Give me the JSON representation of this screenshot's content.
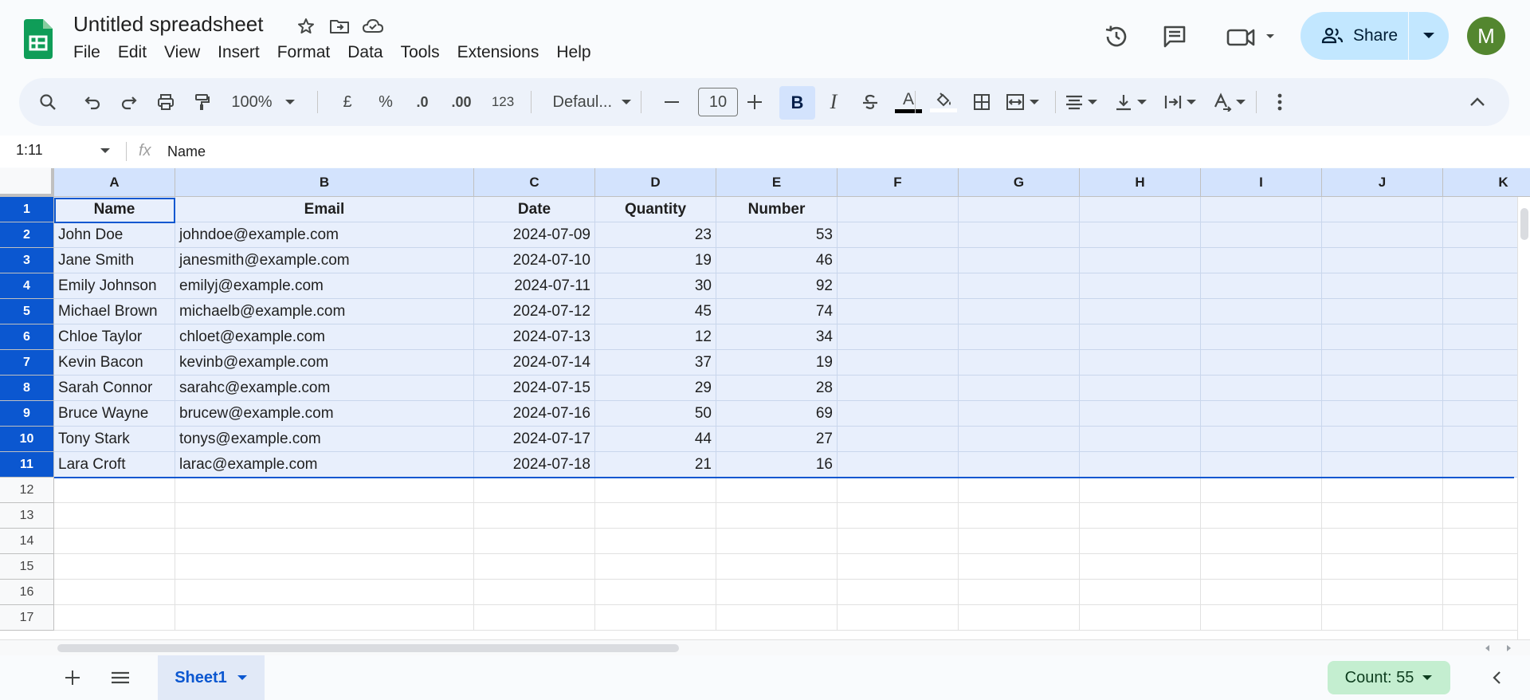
{
  "app": {
    "title": "Untitled spreadsheet",
    "avatar_letter": "M",
    "share_label": "Share"
  },
  "menu": [
    "File",
    "Edit",
    "View",
    "Insert",
    "Format",
    "Data",
    "Tools",
    "Extensions",
    "Help"
  ],
  "toolbar": {
    "zoom": "100%",
    "currency": "£",
    "percent": "%",
    "dec_decrease": ".0",
    "dec_increase": ".00",
    "number_format": "123",
    "font": "Defaul...",
    "font_size": "10",
    "bold": "B",
    "italic": "I",
    "text_color_glyph": "A"
  },
  "formula_bar": {
    "name_box": "1:11",
    "fx": "fx",
    "value": "Name"
  },
  "columns": [
    "A",
    "B",
    "C",
    "D",
    "E",
    "F",
    "G",
    "H",
    "I",
    "J",
    "K"
  ],
  "rows": [
    [
      "Name",
      "Email",
      "Date",
      "Quantity",
      "Number"
    ],
    [
      "John Doe",
      "johndoe@example.com",
      "2024-07-09",
      "23",
      "53"
    ],
    [
      "Jane Smith",
      "janesmith@example.com",
      "2024-07-10",
      "19",
      "46"
    ],
    [
      "Emily Johnson",
      "emilyj@example.com",
      "2024-07-11",
      "30",
      "92"
    ],
    [
      "Michael Brown",
      "michaelb@example.com",
      "2024-07-12",
      "45",
      "74"
    ],
    [
      "Chloe Taylor",
      "chloet@example.com",
      "2024-07-13",
      "12",
      "34"
    ],
    [
      "Kevin Bacon",
      "kevinb@example.com",
      "2024-07-14",
      "37",
      "19"
    ],
    [
      "Sarah Connor",
      "sarahc@example.com",
      "2024-07-15",
      "29",
      "28"
    ],
    [
      "Bruce Wayne",
      "brucew@example.com",
      "2024-07-16",
      "50",
      "69"
    ],
    [
      "Tony Stark",
      "tonys@example.com",
      "2024-07-17",
      "44",
      "27"
    ],
    [
      "Lara Croft",
      "larac@example.com",
      "2024-07-18",
      "21",
      "16"
    ]
  ],
  "row_numbers": [
    "1",
    "2",
    "3",
    "4",
    "5",
    "6",
    "7",
    "8",
    "9",
    "10",
    "11",
    "12",
    "13",
    "14",
    "15",
    "16",
    "17"
  ],
  "sheet": {
    "tab_label": "Sheet1",
    "count_label": "Count: 55"
  },
  "colors": {
    "accent": "#0b57d0",
    "selection_bg": "#e8effc",
    "share_bg": "#c2e7ff",
    "count_bg": "#c4eed0",
    "avatar_bg": "#53862f"
  }
}
